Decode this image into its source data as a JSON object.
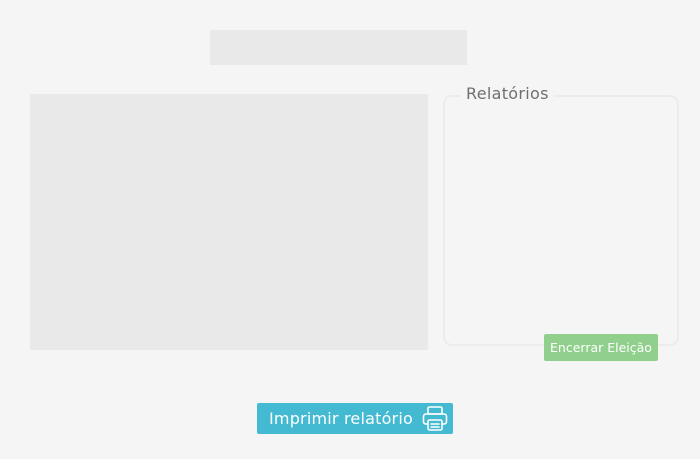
{
  "reports": {
    "title": "Relatórios",
    "end_election_label": "Encerrar Eleição"
  },
  "actions": {
    "print_label": "Imprimir relatório",
    "print_icon": "printer-icon"
  },
  "colors": {
    "background": "#f5f5f5",
    "placeholder": "#e9e9e9",
    "end_election_button": "#90cf8c",
    "print_button": "#43bad1"
  }
}
